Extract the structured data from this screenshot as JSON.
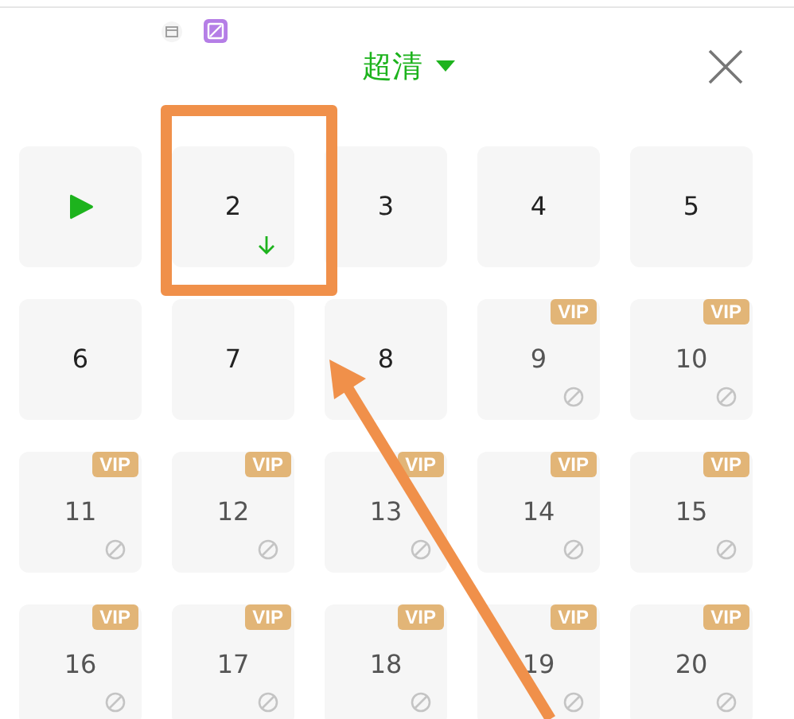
{
  "header": {
    "title": "超清"
  },
  "episodes": [
    {
      "kind": "play"
    },
    {
      "kind": "episode",
      "label": "2",
      "vip": false,
      "downloaded": true
    },
    {
      "kind": "episode",
      "label": "3",
      "vip": false,
      "downloaded": false
    },
    {
      "kind": "episode",
      "label": "4",
      "vip": false,
      "downloaded": false
    },
    {
      "kind": "episode",
      "label": "5",
      "vip": false,
      "downloaded": false
    },
    {
      "kind": "episode",
      "label": "6",
      "vip": false,
      "downloaded": false
    },
    {
      "kind": "episode",
      "label": "7",
      "vip": false,
      "downloaded": false
    },
    {
      "kind": "episode",
      "label": "8",
      "vip": false,
      "downloaded": false
    },
    {
      "kind": "episode",
      "label": "9",
      "vip": true,
      "badge": "VIP",
      "downloaded": false
    },
    {
      "kind": "episode",
      "label": "10",
      "vip": true,
      "badge": "VIP",
      "downloaded": false
    },
    {
      "kind": "episode",
      "label": "11",
      "vip": true,
      "badge": "VIP",
      "downloaded": false
    },
    {
      "kind": "episode",
      "label": "12",
      "vip": true,
      "badge": "VIP",
      "downloaded": false
    },
    {
      "kind": "episode",
      "label": "13",
      "vip": true,
      "badge": "VIP",
      "downloaded": false
    },
    {
      "kind": "episode",
      "label": "14",
      "vip": true,
      "badge": "VIP",
      "downloaded": false
    },
    {
      "kind": "episode",
      "label": "15",
      "vip": true,
      "badge": "VIP",
      "downloaded": false
    },
    {
      "kind": "episode",
      "label": "16",
      "vip": true,
      "badge": "VIP",
      "downloaded": false
    },
    {
      "kind": "episode",
      "label": "17",
      "vip": true,
      "badge": "VIP",
      "downloaded": false
    },
    {
      "kind": "episode",
      "label": "18",
      "vip": true,
      "badge": "VIP",
      "downloaded": false
    },
    {
      "kind": "episode",
      "label": "19",
      "vip": true,
      "badge": "VIP",
      "downloaded": false
    },
    {
      "kind": "episode",
      "label": "20",
      "vip": true,
      "badge": "VIP",
      "downloaded": false
    }
  ]
}
